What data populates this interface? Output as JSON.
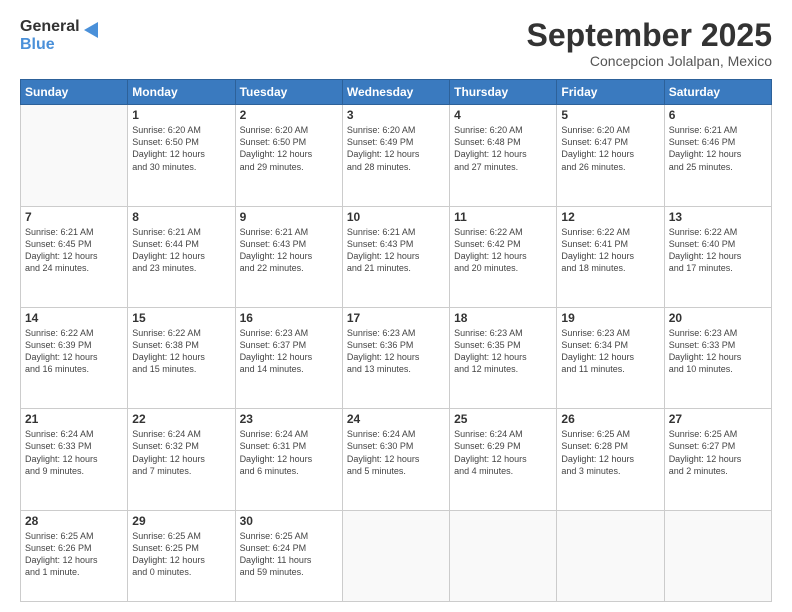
{
  "logo": {
    "general": "General",
    "blue": "Blue"
  },
  "header": {
    "title": "September 2025",
    "subtitle": "Concepcion Jolalpan, Mexico"
  },
  "weekdays": [
    "Sunday",
    "Monday",
    "Tuesday",
    "Wednesday",
    "Thursday",
    "Friday",
    "Saturday"
  ],
  "weeks": [
    [
      {
        "day": "",
        "info": ""
      },
      {
        "day": "1",
        "info": "Sunrise: 6:20 AM\nSunset: 6:50 PM\nDaylight: 12 hours\nand 30 minutes."
      },
      {
        "day": "2",
        "info": "Sunrise: 6:20 AM\nSunset: 6:50 PM\nDaylight: 12 hours\nand 29 minutes."
      },
      {
        "day": "3",
        "info": "Sunrise: 6:20 AM\nSunset: 6:49 PM\nDaylight: 12 hours\nand 28 minutes."
      },
      {
        "day": "4",
        "info": "Sunrise: 6:20 AM\nSunset: 6:48 PM\nDaylight: 12 hours\nand 27 minutes."
      },
      {
        "day": "5",
        "info": "Sunrise: 6:20 AM\nSunset: 6:47 PM\nDaylight: 12 hours\nand 26 minutes."
      },
      {
        "day": "6",
        "info": "Sunrise: 6:21 AM\nSunset: 6:46 PM\nDaylight: 12 hours\nand 25 minutes."
      }
    ],
    [
      {
        "day": "7",
        "info": "Sunrise: 6:21 AM\nSunset: 6:45 PM\nDaylight: 12 hours\nand 24 minutes."
      },
      {
        "day": "8",
        "info": "Sunrise: 6:21 AM\nSunset: 6:44 PM\nDaylight: 12 hours\nand 23 minutes."
      },
      {
        "day": "9",
        "info": "Sunrise: 6:21 AM\nSunset: 6:43 PM\nDaylight: 12 hours\nand 22 minutes."
      },
      {
        "day": "10",
        "info": "Sunrise: 6:21 AM\nSunset: 6:43 PM\nDaylight: 12 hours\nand 21 minutes."
      },
      {
        "day": "11",
        "info": "Sunrise: 6:22 AM\nSunset: 6:42 PM\nDaylight: 12 hours\nand 20 minutes."
      },
      {
        "day": "12",
        "info": "Sunrise: 6:22 AM\nSunset: 6:41 PM\nDaylight: 12 hours\nand 18 minutes."
      },
      {
        "day": "13",
        "info": "Sunrise: 6:22 AM\nSunset: 6:40 PM\nDaylight: 12 hours\nand 17 minutes."
      }
    ],
    [
      {
        "day": "14",
        "info": "Sunrise: 6:22 AM\nSunset: 6:39 PM\nDaylight: 12 hours\nand 16 minutes."
      },
      {
        "day": "15",
        "info": "Sunrise: 6:22 AM\nSunset: 6:38 PM\nDaylight: 12 hours\nand 15 minutes."
      },
      {
        "day": "16",
        "info": "Sunrise: 6:23 AM\nSunset: 6:37 PM\nDaylight: 12 hours\nand 14 minutes."
      },
      {
        "day": "17",
        "info": "Sunrise: 6:23 AM\nSunset: 6:36 PM\nDaylight: 12 hours\nand 13 minutes."
      },
      {
        "day": "18",
        "info": "Sunrise: 6:23 AM\nSunset: 6:35 PM\nDaylight: 12 hours\nand 12 minutes."
      },
      {
        "day": "19",
        "info": "Sunrise: 6:23 AM\nSunset: 6:34 PM\nDaylight: 12 hours\nand 11 minutes."
      },
      {
        "day": "20",
        "info": "Sunrise: 6:23 AM\nSunset: 6:33 PM\nDaylight: 12 hours\nand 10 minutes."
      }
    ],
    [
      {
        "day": "21",
        "info": "Sunrise: 6:24 AM\nSunset: 6:33 PM\nDaylight: 12 hours\nand 9 minutes."
      },
      {
        "day": "22",
        "info": "Sunrise: 6:24 AM\nSunset: 6:32 PM\nDaylight: 12 hours\nand 7 minutes."
      },
      {
        "day": "23",
        "info": "Sunrise: 6:24 AM\nSunset: 6:31 PM\nDaylight: 12 hours\nand 6 minutes."
      },
      {
        "day": "24",
        "info": "Sunrise: 6:24 AM\nSunset: 6:30 PM\nDaylight: 12 hours\nand 5 minutes."
      },
      {
        "day": "25",
        "info": "Sunrise: 6:24 AM\nSunset: 6:29 PM\nDaylight: 12 hours\nand 4 minutes."
      },
      {
        "day": "26",
        "info": "Sunrise: 6:25 AM\nSunset: 6:28 PM\nDaylight: 12 hours\nand 3 minutes."
      },
      {
        "day": "27",
        "info": "Sunrise: 6:25 AM\nSunset: 6:27 PM\nDaylight: 12 hours\nand 2 minutes."
      }
    ],
    [
      {
        "day": "28",
        "info": "Sunrise: 6:25 AM\nSunset: 6:26 PM\nDaylight: 12 hours\nand 1 minute."
      },
      {
        "day": "29",
        "info": "Sunrise: 6:25 AM\nSunset: 6:25 PM\nDaylight: 12 hours\nand 0 minutes."
      },
      {
        "day": "30",
        "info": "Sunrise: 6:25 AM\nSunset: 6:24 PM\nDaylight: 11 hours\nand 59 minutes."
      },
      {
        "day": "",
        "info": ""
      },
      {
        "day": "",
        "info": ""
      },
      {
        "day": "",
        "info": ""
      },
      {
        "day": "",
        "info": ""
      }
    ]
  ]
}
